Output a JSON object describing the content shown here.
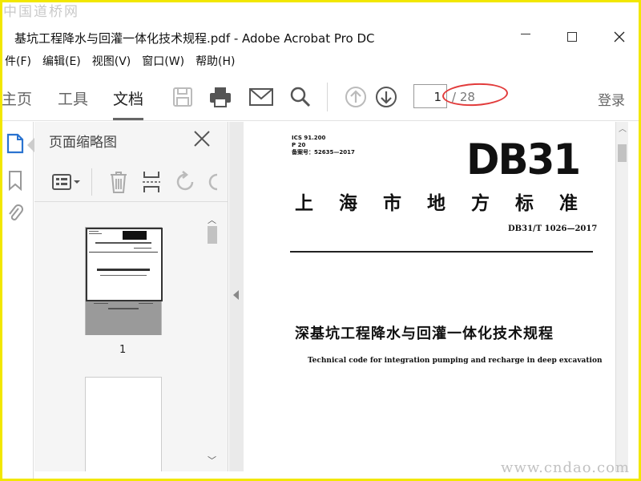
{
  "watermark": {
    "top": "中国道桥网",
    "bottom": "www.cndao.com"
  },
  "window": {
    "title": "基坑工程降水与回灌一体化技术规程.pdf - Adobe Acrobat Pro DC",
    "minimize_icon": "minimize-icon",
    "maximize_icon": "maximize-icon",
    "close_icon": "close-icon"
  },
  "menu": [
    "件(F)",
    "编辑(E)",
    "视图(V)",
    "窗口(W)",
    "帮助(H)"
  ],
  "toolbar": {
    "tabs": [
      "主页",
      "工具",
      "文档"
    ],
    "active_tab": "文档",
    "icons": [
      "save-icon",
      "print-icon",
      "email-icon",
      "search-icon",
      "page-up-icon",
      "page-down-icon"
    ],
    "page_current": "1",
    "page_total": "/ 28",
    "login": "登录"
  },
  "rail": {
    "icons": [
      "page-thumbnails-icon",
      "bookmark-icon",
      "attachment-icon"
    ]
  },
  "thumbnails_panel": {
    "title": "页面缩略图",
    "tools": [
      "options-menu-icon",
      "delete-icon",
      "extract-icon",
      "rotate-icon"
    ],
    "pages": [
      {
        "number": "1",
        "selected": true
      },
      {
        "number": "",
        "selected": false
      }
    ]
  },
  "document": {
    "ics": [
      "ICS 91.200",
      "P 20",
      "备案号：52635—2017"
    ],
    "logo": "DB31",
    "local_standard": "上海市地方标准",
    "standard_number": "DB31/T 1026—2017",
    "title_cn": "深基坑工程降水与回灌一体化技术规程",
    "title_en": "Technical code for integration pumping and recharge in deep excavation"
  },
  "colors": {
    "highlight_ellipse": "#e23b3b",
    "frame": "#f2e700"
  }
}
